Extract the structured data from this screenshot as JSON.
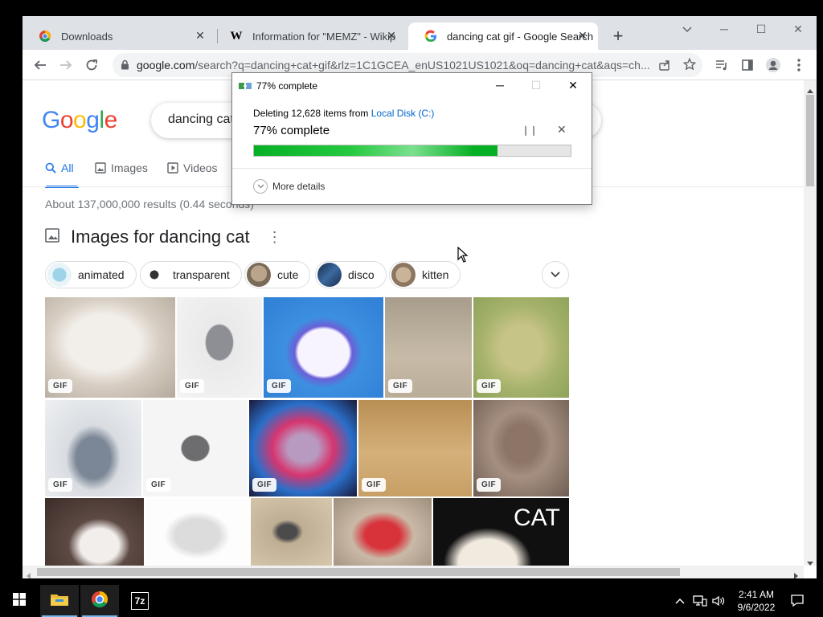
{
  "browser": {
    "tabs": [
      {
        "title": "Downloads",
        "icon": "chrome-downloads-icon"
      },
      {
        "title": "Information for \"MEMZ\" - Wikip",
        "icon": "wikipedia-icon"
      },
      {
        "title": "dancing cat gif - Google Search",
        "icon": "google-icon",
        "active": true
      }
    ],
    "new_tab_label": "+",
    "url_host": "google.com",
    "url_path": "/search?q=dancing+cat+gif&rlz=1C1GCEA_enUS1021US1021&oq=dancing+cat&aqs=ch..."
  },
  "search": {
    "logo": [
      "G",
      "o",
      "o",
      "g",
      "l",
      "e"
    ],
    "logo_colors": [
      "#4285f4",
      "#ea4335",
      "#fbbc05",
      "#4285f4",
      "#34a853",
      "#ea4335"
    ],
    "query": "dancing cat",
    "tabs": [
      {
        "label": "All",
        "icon": "search-icon",
        "active": true
      },
      {
        "label": "Images",
        "icon": "image-icon"
      },
      {
        "label": "Videos",
        "icon": "video-icon"
      }
    ],
    "stats": "About 137,000,000 results (0.44 seconds)",
    "images_heading": "Images for dancing cat",
    "chips": [
      "animated",
      "transparent",
      "cute",
      "disco",
      "kitten"
    ],
    "gif_label": "GIF",
    "cat_text": "CAT"
  },
  "dialog": {
    "title": "77% complete",
    "line1_prefix": "Deleting 12,628 items from ",
    "line1_link": "Local Disk (C:)",
    "line2": "77% complete",
    "progress": 0.77,
    "more_details": "More details",
    "accent": "#06b025"
  },
  "taskbar": {
    "time": "2:41 AM",
    "date": "9/6/2022",
    "apps": [
      "file-explorer-icon",
      "chrome-icon",
      "7zip-icon"
    ],
    "seven_zip_label": "7z"
  }
}
